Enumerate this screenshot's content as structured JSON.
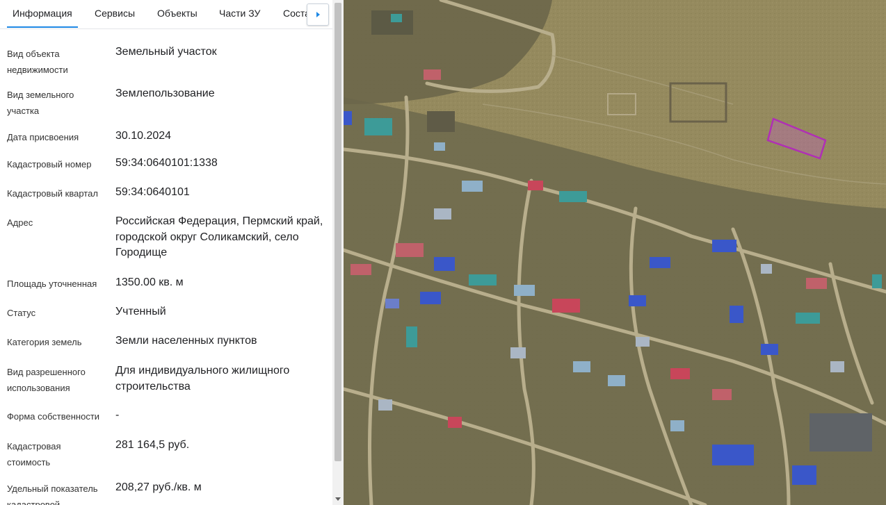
{
  "tabs": [
    {
      "label": "Информация",
      "active": true
    },
    {
      "label": "Сервисы",
      "active": false
    },
    {
      "label": "Объекты",
      "active": false
    },
    {
      "label": "Части ЗУ",
      "active": false
    },
    {
      "label": "Соста",
      "active": false
    }
  ],
  "tab_next_icon": "chevron-right-icon",
  "info": [
    {
      "label": "Вид объекта недвижимости",
      "value": "Земельный участок"
    },
    {
      "label": "Вид земельного участка",
      "value": "Землепользование"
    },
    {
      "label": "Дата присвоения",
      "value": "30.10.2024"
    },
    {
      "label": "Кадастровый номер",
      "value": "59:34:0640101:1338"
    },
    {
      "label": "Кадастровый квартал",
      "value": "59:34:0640101"
    },
    {
      "label": "Адрес",
      "value": "Российская Федерация, Пермский край, городской округ Соликамский, село Городище"
    },
    {
      "label": "Площадь уточненная",
      "value": "1350.00 кв. м"
    },
    {
      "label": "Статус",
      "value": "Учтенный"
    },
    {
      "label": "Категория земель",
      "value": "Земли населенных пунктов"
    },
    {
      "label": "Вид разрешенного использования",
      "value": "Для индивидуального жилищного строительства"
    },
    {
      "label": "Форма собственности",
      "value": "-"
    },
    {
      "label": "Кадастровая стоимость",
      "value": "281 164,5 руб."
    },
    {
      "label": "Удельный показатель кадастровой",
      "value": "208,27 руб./кв. м"
    }
  ],
  "colors": {
    "accent": "#1e88e5",
    "parcel_outline": "#b02fb5",
    "parcel_fill": "#c05fbf",
    "field": "#958a5e"
  }
}
